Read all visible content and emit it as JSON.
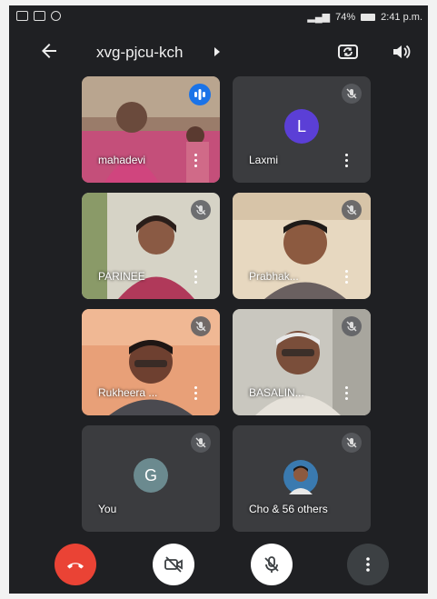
{
  "status_bar": {
    "battery": "74%",
    "time": "2:41 p.m."
  },
  "header": {
    "meeting_code": "xvg-pjcu-kch"
  },
  "participants": [
    {
      "name": "mahadevi",
      "muted": false,
      "speaking": true,
      "avatar": "photo"
    },
    {
      "name": "Laxmi",
      "muted": true,
      "speaking": false,
      "avatar": "letter",
      "letter": "L",
      "avatar_color": "#5b3fd6"
    },
    {
      "name": "PARINEE",
      "muted": true,
      "speaking": false,
      "avatar": "photo"
    },
    {
      "name": "Prabhak...",
      "muted": true,
      "speaking": false,
      "avatar": "photo"
    },
    {
      "name": "Rukheera ...",
      "muted": true,
      "speaking": false,
      "avatar": "photo"
    },
    {
      "name": "BASALIN...",
      "muted": true,
      "speaking": false,
      "avatar": "photo"
    },
    {
      "name": "You",
      "muted": true,
      "speaking": false,
      "avatar": "letter",
      "letter": "G",
      "avatar_color": "#6b8a8f"
    },
    {
      "name": "Cho & 56 others",
      "muted": true,
      "speaking": false,
      "avatar": "photo"
    }
  ],
  "controls": {
    "end_call_color": "#ea4335",
    "camera_state": "off",
    "mic_state": "muted",
    "more_icon": "more-vert-icon"
  }
}
